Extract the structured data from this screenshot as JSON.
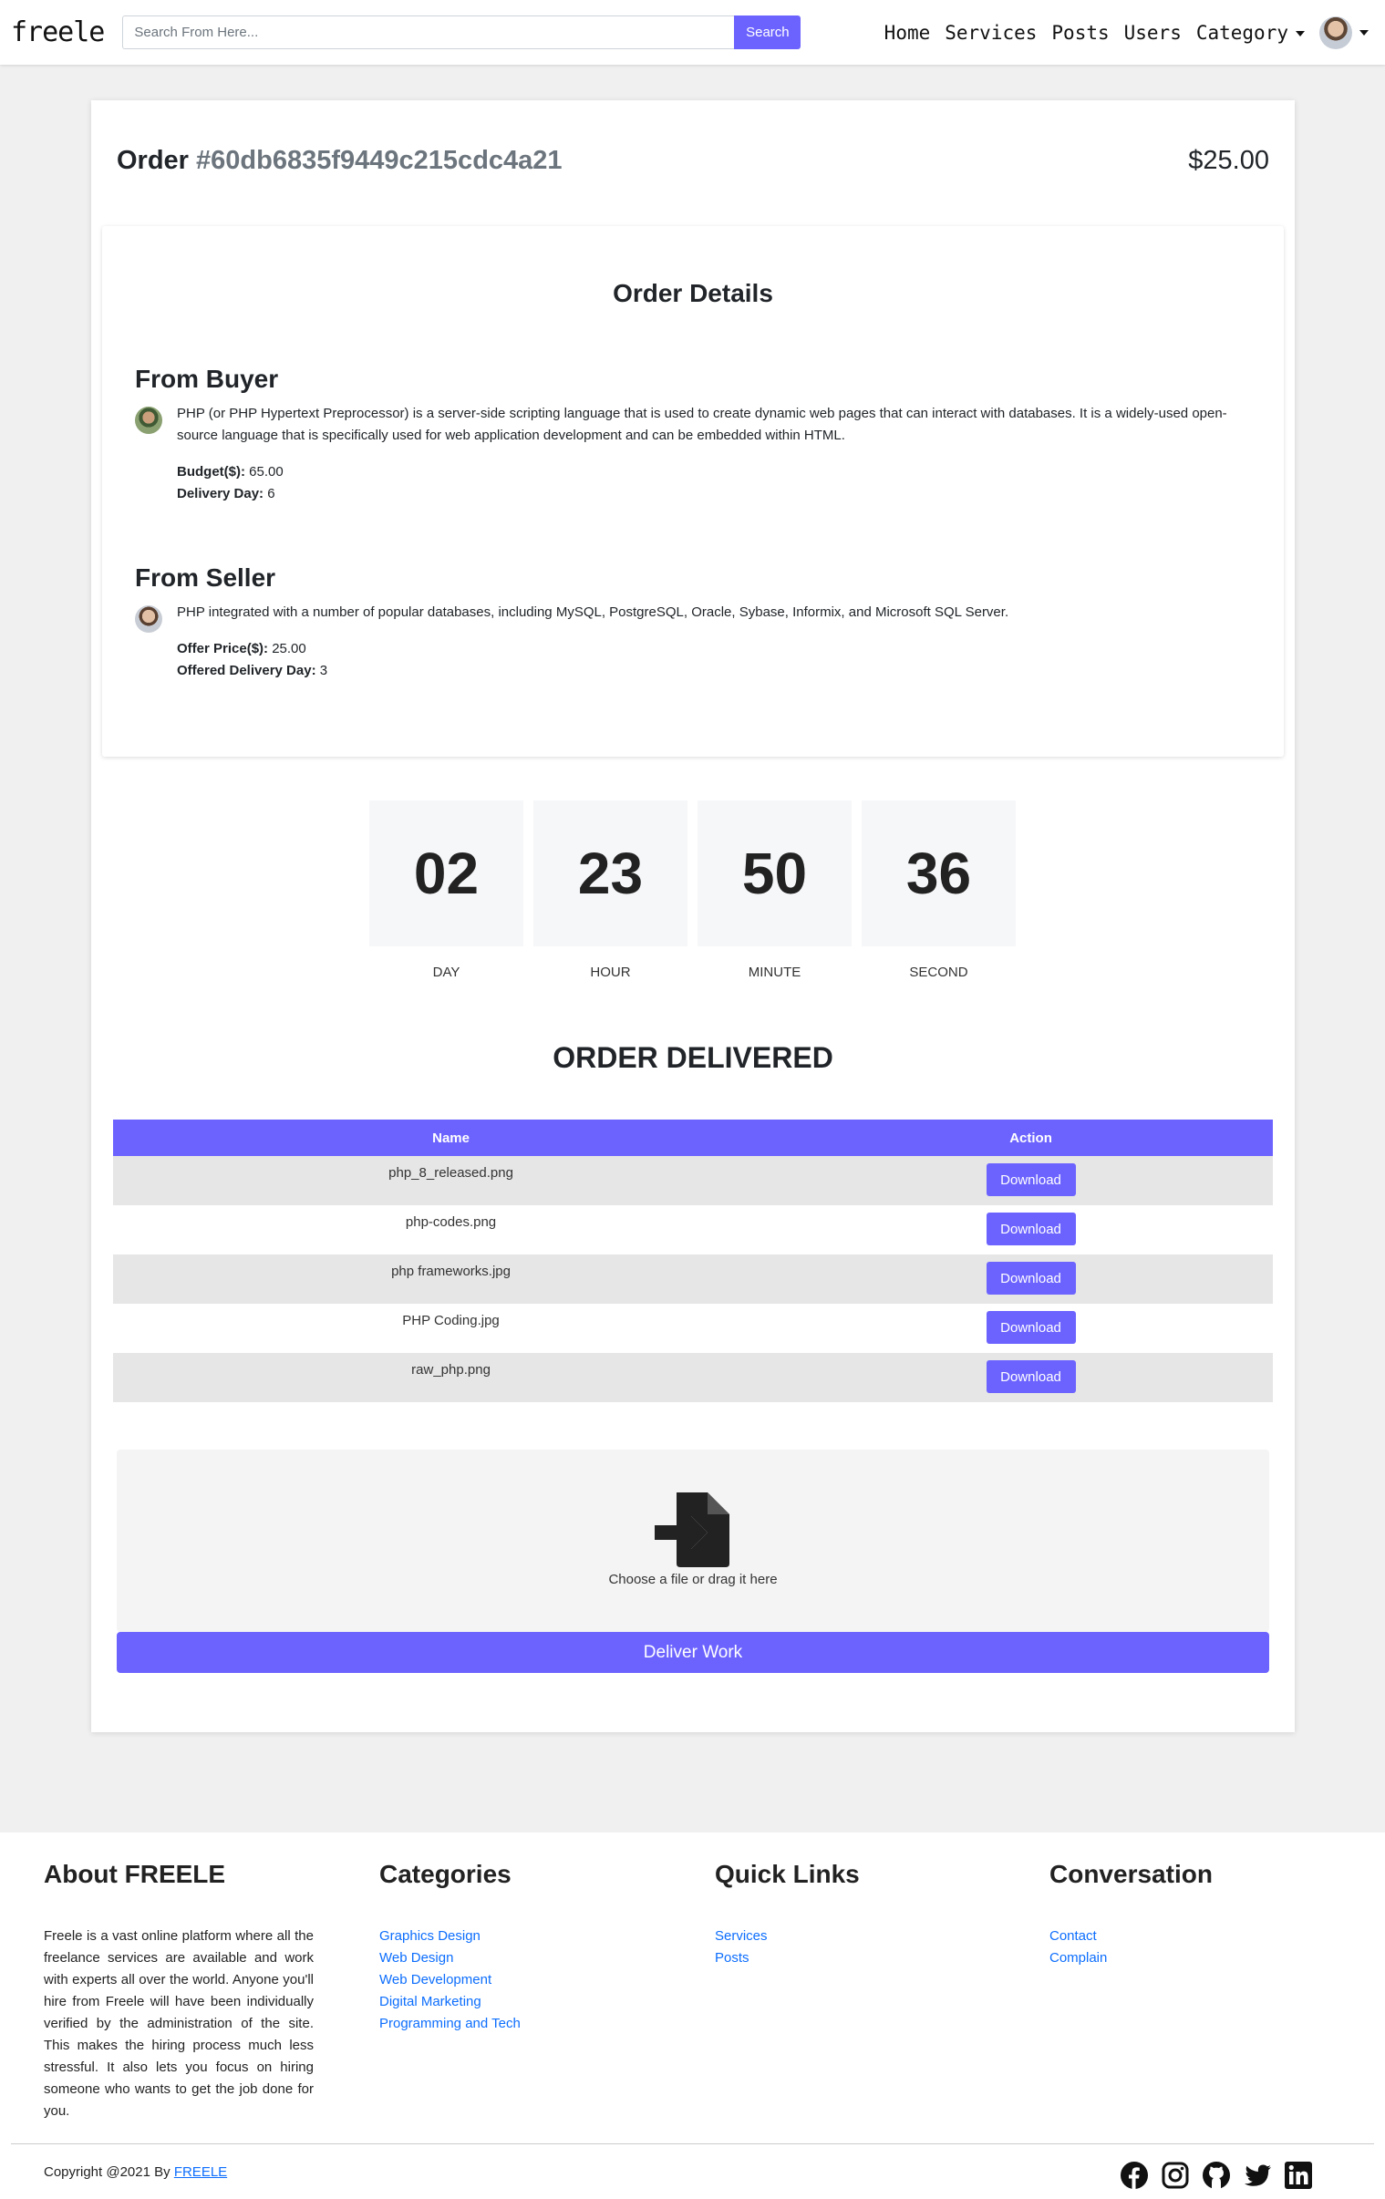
{
  "nav": {
    "brand": "freele",
    "search_placeholder": "Search From Here...",
    "search_button": "Search",
    "links": [
      "Home",
      "Services",
      "Posts",
      "Users"
    ],
    "category": "Category"
  },
  "order": {
    "label": "Order",
    "id": "#60db6835f9449c215cdc4a21",
    "price": "$25.00"
  },
  "details": {
    "title": "Order Details",
    "buyer": {
      "title": "From Buyer",
      "message": "PHP (or PHP Hypertext Preprocessor) is a server-side scripting language that is used to create dynamic web pages that can interact with databases. It is a widely-used open-source language that is specifically used for web application development and can be embedded within HTML.",
      "budget_label": "Budget($):",
      "budget": "65.00",
      "delivery_label": "Delivery Day:",
      "delivery": "6"
    },
    "seller": {
      "title": "From Seller",
      "message": "PHP integrated with a number of popular databases, including MySQL, PostgreSQL, Oracle, Sybase, Informix, and Microsoft SQL Server.",
      "offer_label": "Offer Price($):",
      "offer": "25.00",
      "offered_delivery_label": "Offered Delivery Day:",
      "offered_delivery": "3"
    }
  },
  "countdown": [
    {
      "value": "02",
      "label": "DAY"
    },
    {
      "value": "23",
      "label": "HOUR"
    },
    {
      "value": "50",
      "label": "MINUTE"
    },
    {
      "value": "36",
      "label": "SECOND"
    }
  ],
  "delivered": {
    "title": "ORDER DELIVERED",
    "headers": [
      "Name",
      "Action"
    ],
    "files": [
      "php_8_released.png",
      "php-codes.png",
      "php frameworks.jpg",
      "PHP Coding.jpg",
      "raw_php.png"
    ],
    "action_label": "Download"
  },
  "upload": {
    "text": "Choose a file or drag it here",
    "button": "Deliver Work"
  },
  "footer": {
    "about_title": "About FREELE",
    "about_text": "Freele is a vast online platform where all the freelance services are available and work with experts all over the world. Anyone you'll hire from Freele will have been individually verified by the administration of the site. This makes the hiring process much less stressful. It also lets you focus on hiring someone who wants to get the job done for you.",
    "categories_title": "Categories",
    "categories": [
      "Graphics Design",
      "Web Design",
      "Web Development",
      "Digital Marketing",
      "Programming and Tech"
    ],
    "quick_title": "Quick Links",
    "quick_links": [
      "Services",
      "Posts"
    ],
    "conv_title": "Conversation",
    "conv_links": [
      "Contact",
      "Complain"
    ],
    "copyright": "Copyright @2021 By ",
    "copyright_link": "FREELE",
    "socials": [
      "facebook-icon",
      "instagram-icon",
      "github-icon",
      "twitter-icon",
      "linkedin-icon"
    ]
  },
  "colors": {
    "accent": "#6c63ff",
    "link": "#0d6efd",
    "page_bg": "#f0f0f0"
  }
}
